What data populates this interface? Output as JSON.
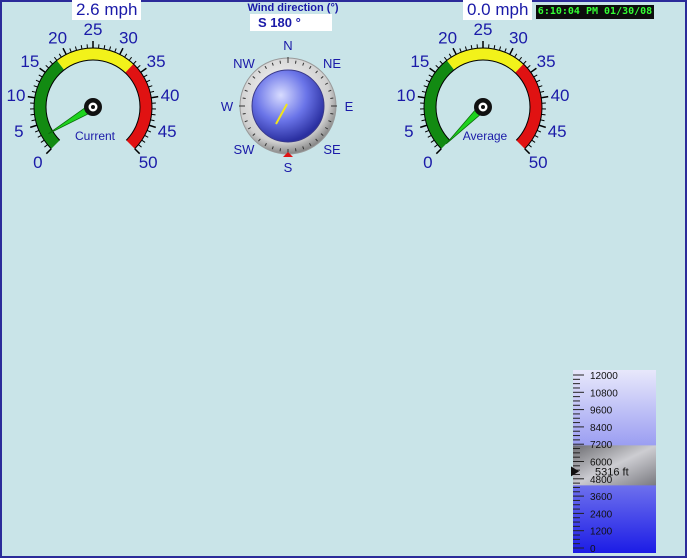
{
  "current_speed": {
    "value": 2.6,
    "text": "2.6 mph",
    "label": "Current"
  },
  "average_speed": {
    "value": 0.0,
    "text": "0.0 mph",
    "label": "Average"
  },
  "gauge_scale": {
    "min": 0,
    "max": 50,
    "ticks": [
      "0",
      "5",
      "10",
      "15",
      "20",
      "25",
      "30",
      "35",
      "40",
      "45",
      "50"
    ],
    "zones": [
      {
        "from": 0,
        "to": 18,
        "color": "#128a12"
      },
      {
        "from": 18,
        "to": 33,
        "color": "#f2f21a"
      },
      {
        "from": 33,
        "to": 50,
        "color": "#e01212"
      }
    ]
  },
  "wind_direction": {
    "title": "Wind direction (°)",
    "value_text": "S  180 °",
    "degrees": 180,
    "cardinals": [
      "N",
      "NE",
      "E",
      "SE",
      "S",
      "SW",
      "W",
      "NW"
    ]
  },
  "clock": {
    "text": "6:10:04 PM 01/30/08"
  },
  "altitude": {
    "scale": [
      "12000",
      "10800",
      "9600",
      "8400",
      "7200",
      "6000",
      "4800",
      "3600",
      "2400",
      "1200",
      "0"
    ],
    "value": 5316,
    "value_text": "5316 ft",
    "max": 12000
  },
  "colors": {
    "background": "#c9e4e8",
    "text": "#1a1aa8",
    "needle": "#1ed31e"
  }
}
